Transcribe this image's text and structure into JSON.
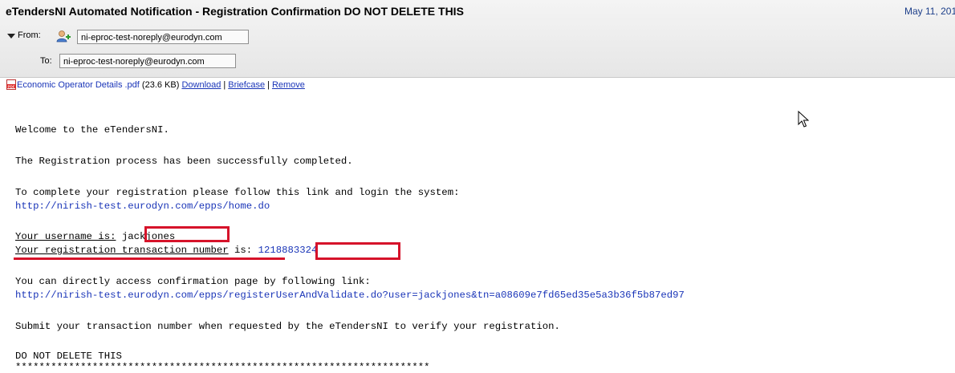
{
  "email": {
    "subject": "eTendersNI Automated Notification - Registration Confirmation DO NOT DELETE THIS",
    "date": "May 11, 201",
    "from_label": "From:",
    "from_address": "ni-eproc-test-noreply@eurodyn.com",
    "to_label": "To:",
    "to_address": "ni-eproc-test-noreply@eurodyn.com"
  },
  "attachment": {
    "icon": "pdf-icon",
    "name": "Economic Operator Details .pdf",
    "size": "(23.6 KB)",
    "download": "Download",
    "briefcase": "Briefcase",
    "remove": "Remove",
    "sep": "|"
  },
  "body": {
    "welcome": "Welcome to the eTendersNI.",
    "completed": "The Registration process has been successfully completed.",
    "follow_link": "To complete your registration please follow this link and login the system:",
    "home_link": "http://nirish-test.eurodyn.com/epps/home.do",
    "username_label": "Your username is:",
    "username": "jackjones",
    "txn_label": "Your registration transaction number",
    "txn_is": "is:",
    "txn_number": "1218883324",
    "direct_access": "You can directly access confirmation page by following link:",
    "confirm_link": "http://nirish-test.eurodyn.com/epps/registerUserAndValidate.do?user=jackjones&tn=a08609e7fd65ed35e5a3b36f5b87ed97",
    "submit_note": "Submit your transaction number when requested by the eTendersNI to verify your registration.",
    "do_not_delete": "DO NOT DELETE THIS",
    "stars": "**********************************************************************"
  },
  "colors": {
    "highlight": "#d6132a",
    "link": "#1a35b8"
  }
}
